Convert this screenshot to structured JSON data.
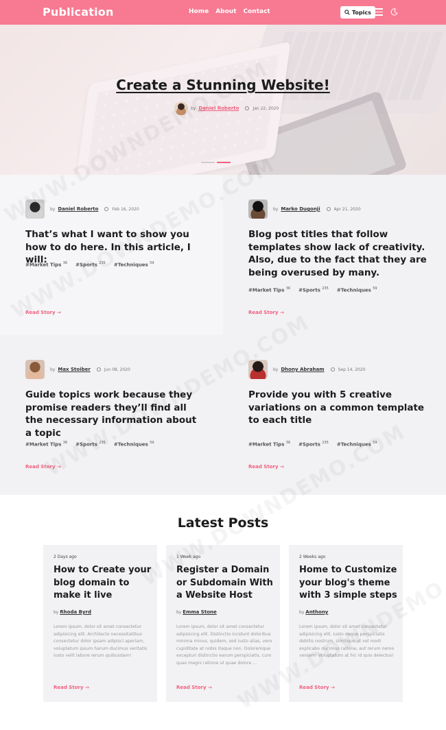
{
  "header": {
    "brand": "Publication",
    "nav": [
      "Home",
      "About",
      "Contact"
    ],
    "topics_label": "Topics",
    "colors": {
      "bar": "#f77a92",
      "accent": "#f06181"
    }
  },
  "hero": {
    "title": "Create a Stunning Website!",
    "by": "by",
    "author": "Daniel Roberto",
    "date": "Jan 22, 2020"
  },
  "featured": [
    {
      "by": "by",
      "author": "Daniel Roberto",
      "date": "Feb 16, 2020",
      "title": "That’s what I want to show you how to do here. In this article, I will:",
      "tags": [
        {
          "label": "#Market Tips",
          "count": "36"
        },
        {
          "label": "#Sports",
          "count": "235"
        },
        {
          "label": "#Techniques",
          "count": "59"
        }
      ],
      "read": "Read Story →"
    },
    {
      "by": "by",
      "author": "Marko Dugonji",
      "date": "Apr 21, 2020",
      "title": "Blog post titles that follow templates show lack of creativity. Also, due to the fact that they are being overused by many.",
      "tags": [
        {
          "label": "#Market Tips",
          "count": "36"
        },
        {
          "label": "#Sports",
          "count": "235"
        },
        {
          "label": "#Techniques",
          "count": "59"
        }
      ],
      "read": "Read Story →"
    },
    {
      "by": "by",
      "author": "Max Stoiber",
      "date": "Jun 08, 2020",
      "title": "Guide topics work because they promise readers they’ll find all the necessary information about a topic",
      "tags": [
        {
          "label": "#Market Tips",
          "count": "36"
        },
        {
          "label": "#Sports",
          "count": "235"
        },
        {
          "label": "#Techniques",
          "count": "59"
        }
      ],
      "read": "Read Story →"
    },
    {
      "by": "by",
      "author": "Dhony Abraham",
      "date": "Sep 14, 2020",
      "title": "Provide you with 5 creative variations on a common template to each title",
      "tags": [
        {
          "label": "#Market Tips",
          "count": "36"
        },
        {
          "label": "#Sports",
          "count": "235"
        },
        {
          "label": "#Techniques",
          "count": "59"
        }
      ],
      "read": "Read Story →"
    }
  ],
  "latest": {
    "title": "Latest Posts",
    "posts": [
      {
        "ago": "2 Days ago",
        "title": "How to Create your blog domain to make it live",
        "by": "by",
        "author": "Rhoda Byrd",
        "excerpt": "Lorem ipsum, dolor sit amet consectetur adipisicing elit. Architecto necessitatibus consectetur dolor ipsam adipisci aperiam, voluptatum ipsum harum ducimus veritatis iusto velit labore rerum quibusdam!",
        "read": "Read Story →"
      },
      {
        "ago": "1 Week ago",
        "title": "Register a Domain or Subdomain With a Website Host",
        "by": "by",
        "author": "Emma Stone",
        "excerpt": "Lorem ipsum, dolor sit amet consectetur adipisicing elit. Distinctio incidunt doloribus minima minus, quidem, sed iusto alias, vero cupiditate at nobis itaque non. Doloremque excepturi distinctio earum perspiciatis, cum quas magni ratione ut quae dolore ...",
        "read": "Read Story →"
      },
      {
        "ago": "2 Weeks ago",
        "title": "Home to Customize your blog's theme with 3 simple steps",
        "by": "by",
        "author": "Anthony",
        "excerpt": "Lorem ipsum, dolor sit amet consectetur adipisicing elit. Iusto neque perspiciatis debitis nostrum, similique ut vel modi explicabo ducimus ratione, aut rerum nemo veniam! Voluptatum at hic id quis delectus!",
        "read": "Read Story →"
      }
    ]
  },
  "watermark": "WWW.DOWNDEMO.COM"
}
